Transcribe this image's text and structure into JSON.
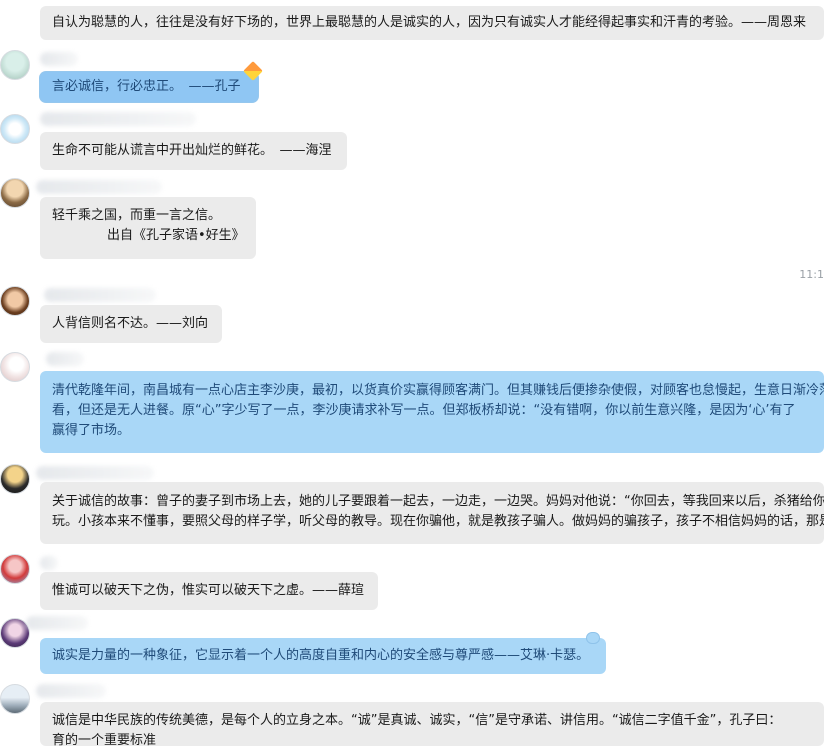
{
  "chat": {
    "timestamp": "11:1",
    "messages": [
      {
        "type": "received",
        "lines": [
          "自认为聪慧的人，往往是没有好下场的，世界上最聪慧的人是诚实的人，因为只有诚实人才能经得起事实和汗青的考验。——周恩来"
        ]
      },
      {
        "type": "received",
        "style": "blue-glow",
        "lines": [
          "言必诚信，行必忠正。　——孔子"
        ]
      },
      {
        "type": "received",
        "lines": [
          "生命不可能从谎言中开出灿烂的鲜花。　——海涅"
        ]
      },
      {
        "type": "received",
        "lines": [
          "轻千乘之国，而重一言之信。",
          "出自《孔子家语•好生》"
        ]
      },
      {
        "type": "received",
        "lines": [
          "人背信则名不达。——刘向"
        ]
      },
      {
        "type": "received",
        "style": "blue",
        "lines": [
          "清代乾隆年间，南昌城有一点心店主李沙庚，最初，以货真价实赢得顾客满门。但其赚钱后便掺杂使假，对顾客也怠慢起，生意日渐冷落",
          "看，但还是无人进餐。原“心”字少写了一点，李沙庚请求补写一点。但郑板桥却说：“没有错啊，你以前生意兴隆，是因为‘心’有了",
          "赢得了市场。"
        ]
      },
      {
        "type": "received",
        "lines": [
          "关于诚信的故事：曾子的妻子到市场上去，她的儿子要跟着一起去，一边走，一边哭。妈妈对他说：“你回去，等我回来以后，杀猪给你",
          "玩。小孩本来不懂事，要照父母的样子学，听父母的教导。现在你骗他，就是教孩子骗人。做妈妈的骗孩子，孩子不相信妈妈的话，那是"
        ]
      },
      {
        "type": "received",
        "lines": [
          "惟诚可以破天下之伪，惟实可以破天下之虚。——薛瑄"
        ]
      },
      {
        "type": "received",
        "style": "blue",
        "lines": [
          "诚实是力量的一种象征，它显示着一个人的高度自重和内心的安全感与尊严感——艾琳·卡瑟。"
        ]
      },
      {
        "type": "received",
        "lines": [
          "诚信是中华民族的传统美德，是每个人的立身之本。“诚”是真诚、诚实，“信”是守承诺、讲信用。“诚信二字值千金”，孔子曰：",
          "育的一个重要标准"
        ]
      }
    ]
  },
  "colors": {
    "bubble_gray": "#ebebeb",
    "bubble_blue": "#a9d7f7",
    "bubble_text_blue": "#1f4a78"
  },
  "icons": [
    "avatar",
    "kite-sticker-icon",
    "bubble-corner-icon"
  ]
}
